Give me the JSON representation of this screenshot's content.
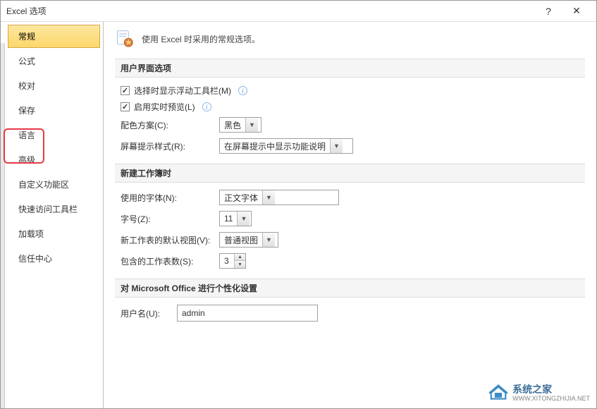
{
  "window": {
    "title": "Excel 选项",
    "help_btn": "?",
    "close_btn": "✕"
  },
  "sidebar": {
    "items": [
      {
        "label": "常规",
        "selected": true
      },
      {
        "label": "公式"
      },
      {
        "label": "校对"
      },
      {
        "label": "保存"
      },
      {
        "label": "语言"
      },
      {
        "label": "高级"
      },
      {
        "label": "自定义功能区"
      },
      {
        "label": "快速访问工具栏"
      },
      {
        "label": "加载项"
      },
      {
        "label": "信任中心"
      }
    ]
  },
  "header": {
    "description": "使用 Excel 时采用的常规选项。"
  },
  "sections": {
    "ui": {
      "title": "用户界面选项",
      "show_mini_toolbar": "选择时显示浮动工具栏(M)",
      "live_preview": "启用实时预览(L)",
      "color_scheme_label": "配色方案(C):",
      "color_scheme_value": "黑色",
      "screentip_label": "屏幕提示样式(R):",
      "screentip_value": "在屏幕提示中显示功能说明"
    },
    "workbook": {
      "title": "新建工作簿时",
      "font_label": "使用的字体(N):",
      "font_value": "正文字体",
      "size_label": "字号(Z):",
      "size_value": "11",
      "view_label": "新工作表的默认视图(V):",
      "view_value": "普通视图",
      "sheets_label": "包含的工作表数(S):",
      "sheets_value": "3"
    },
    "personalize": {
      "title": "对 Microsoft Office 进行个性化设置",
      "username_label": "用户名(U):",
      "username_value": "admin"
    }
  },
  "watermark": {
    "name": "系统之家",
    "url": "WWW.XITONGZHIJIA.NET"
  }
}
